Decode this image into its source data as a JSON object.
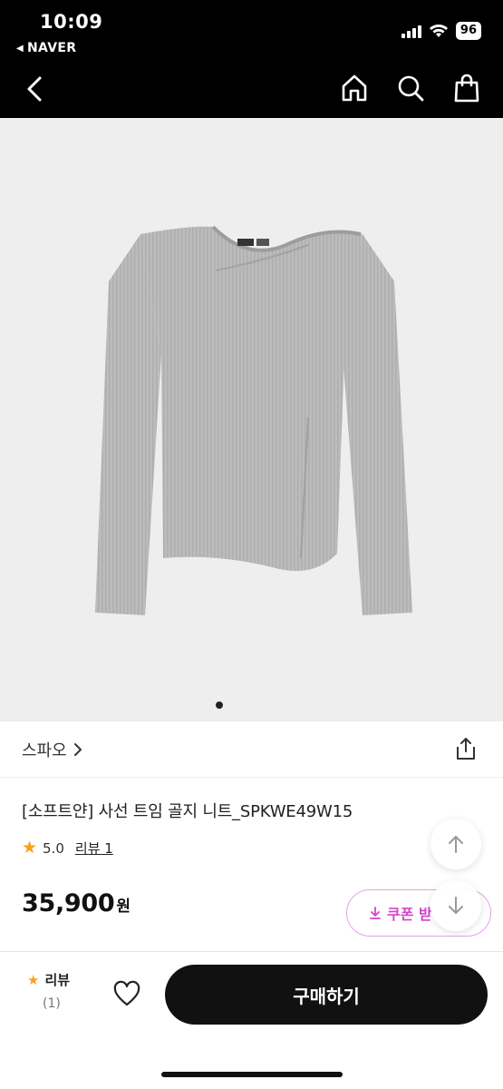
{
  "status_bar": {
    "time": "10:09",
    "back_app": "NAVER",
    "battery": "96"
  },
  "product": {
    "brand": "스파오",
    "title": "[소프트얀] 사선 트임 골지 니트_SPKWE49W15",
    "rating": "5.0",
    "review_link": "리뷰 1",
    "price": "35,900",
    "price_unit": "원",
    "image_count": 1,
    "current_image": 1
  },
  "coupon": {
    "label": "쿠폰 받"
  },
  "bottom_bar": {
    "review_label": "리뷰",
    "review_count": "(1)",
    "buy_label": "구매하기"
  },
  "colors": {
    "header_bg": "#000000",
    "coupon_accent": "#d545c9",
    "star": "#f7a21b",
    "buy_bg": "#111111"
  },
  "icons": [
    "back-chevron-icon",
    "home-icon",
    "search-icon",
    "shopping-bag-icon",
    "share-icon",
    "chevron-right-icon",
    "star-icon",
    "arrow-up-icon",
    "arrow-down-icon",
    "download-icon",
    "heart-icon"
  ]
}
